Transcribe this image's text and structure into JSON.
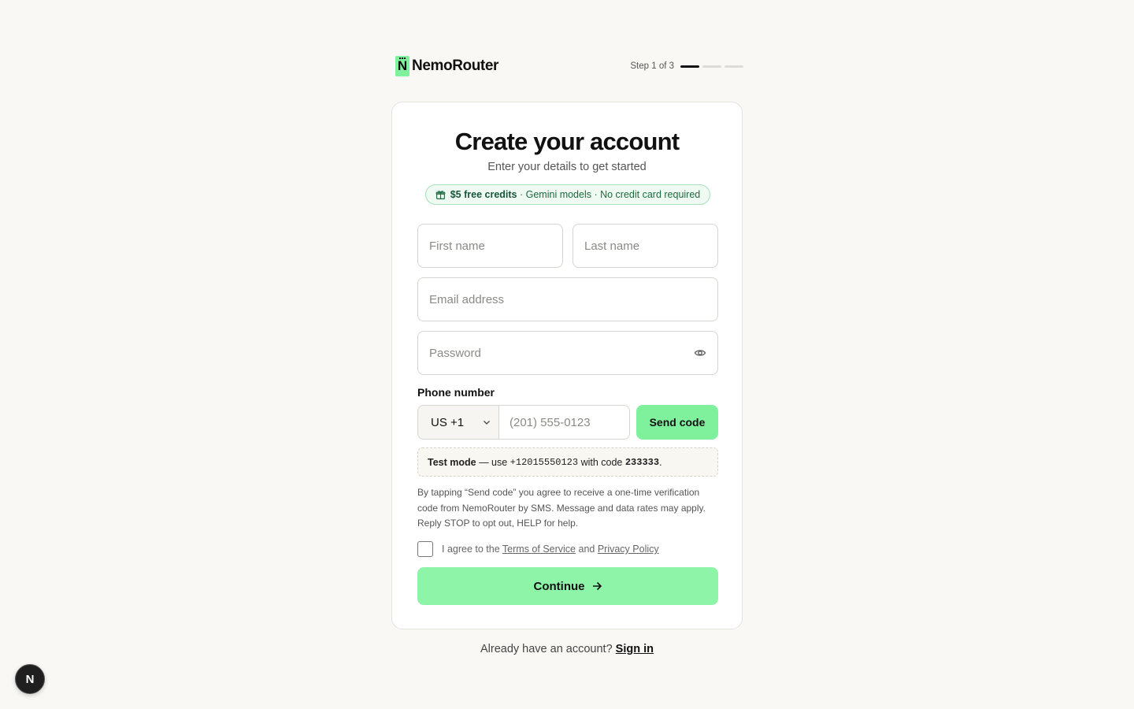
{
  "brand": {
    "name": "NemoRouter",
    "logo_letter": "N"
  },
  "progress": {
    "text": "Step 1 of 3",
    "current": 1,
    "total": 3
  },
  "card": {
    "title": "Create your account",
    "subtitle": "Enter your details to get started",
    "promo": {
      "icon": "gift-icon",
      "highlight": "$5 free credits",
      "rest": " · Gemini models · No credit card required"
    }
  },
  "form": {
    "first_name": {
      "placeholder": "First name",
      "value": ""
    },
    "last_name": {
      "placeholder": "Last name",
      "value": ""
    },
    "email": {
      "placeholder": "Email address",
      "value": ""
    },
    "password": {
      "placeholder": "Password",
      "value": "",
      "toggle_icon": "eye-icon"
    },
    "phone": {
      "label": "Phone number",
      "country": "US +1",
      "placeholder": "(201) 555-0123",
      "value": "",
      "send_label": "Send code"
    }
  },
  "test_mode": {
    "label": "Test mode",
    "pre": " — use ",
    "number": "+12015550123",
    "mid": " with code ",
    "code": "233333",
    "post": "."
  },
  "consent": "By tapping “Send code” you agree to receive a one-time verification code from NemoRouter by SMS. Message and data rates may apply. Reply STOP to opt out, HELP for help.",
  "agree": {
    "checked": false,
    "prefix": "I agree to the ",
    "terms": "Terms of Service",
    "and": " and ",
    "privacy": "Privacy Policy"
  },
  "continue_label": "Continue",
  "footer": {
    "prompt": "Already have an account? ",
    "signin": "Sign in"
  },
  "dev_badge": "N",
  "colors": {
    "accent": "#7ff09c",
    "background": "#f9f8f5",
    "promo_text": "#1d6b3e"
  }
}
